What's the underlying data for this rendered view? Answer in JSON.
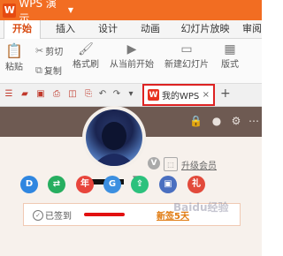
{
  "app": {
    "name": "WPS 演示",
    "logo_letter": "W"
  },
  "tabs": [
    {
      "label": "开始"
    },
    {
      "label": "插入"
    },
    {
      "label": "设计"
    },
    {
      "label": "动画"
    },
    {
      "label": "幻灯片放映"
    },
    {
      "label": "审阅"
    }
  ],
  "ribbon": {
    "cut": "剪切",
    "copy": "复制",
    "paste": "粘贴",
    "format_painter": "格式刷",
    "from_current": "从当前开始",
    "new_slide": "新建幻灯片",
    "layout": "版式"
  },
  "doc_tab": {
    "label": "我的WPS",
    "close": "×"
  },
  "new_tab": "+",
  "profile": {
    "upgrade": "升级会员",
    "vip_letter": "V"
  },
  "apps": [
    {
      "glyph": "D",
      "color": "#2f86e0"
    },
    {
      "glyph": "⇄",
      "color": "#27ae60"
    },
    {
      "glyph": "年",
      "color": "#e8453c"
    },
    {
      "glyph": "G",
      "color": "#3c8fe0"
    },
    {
      "glyph": "⇪",
      "color": "#2cc17d"
    },
    {
      "glyph": "▣",
      "color": "#4a6fc0"
    },
    {
      "glyph": "礼",
      "color": "#e24a3b"
    }
  ],
  "sign": {
    "status": "已签到",
    "link": "新签5天"
  },
  "watermark": "Baidu经验",
  "colors": {
    "title_bar": "#f26d22",
    "accent": "#d84a10",
    "highlight": "#dd2222"
  }
}
